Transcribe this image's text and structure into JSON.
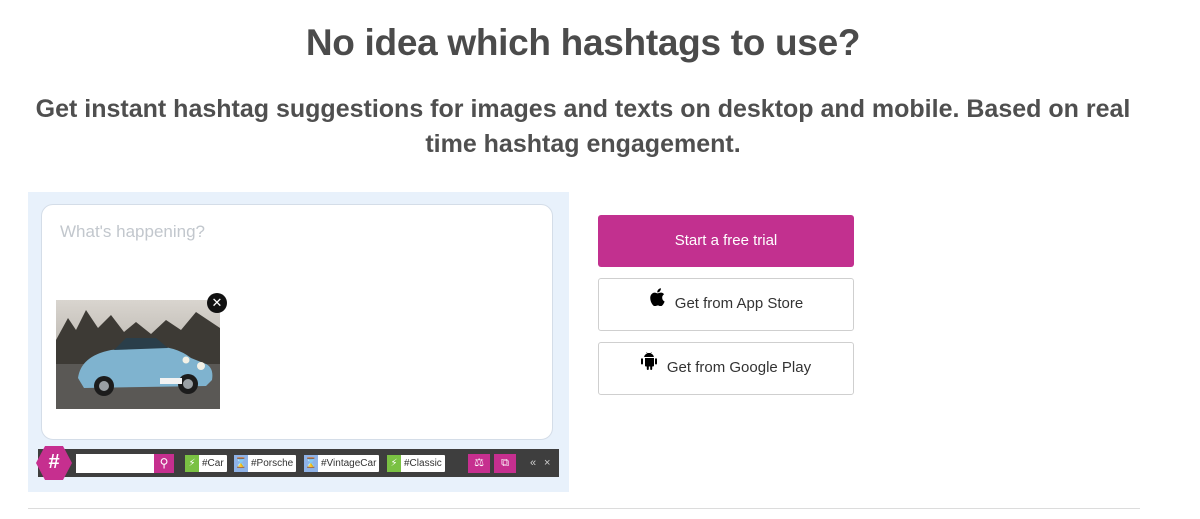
{
  "hero": {
    "title": "No idea which hashtags to use?",
    "subtitle": "Get instant hashtag suggestions for images and texts on desktop and mobile. Based on real time hashtag engagement."
  },
  "composer": {
    "placeholder": "What's happening?",
    "remove_icon": "close-icon",
    "image_subject": "light blue vintage car"
  },
  "toolbar": {
    "logo": "#",
    "search_icon": "search-icon",
    "tags": [
      {
        "label": "#Car",
        "status": "hot",
        "icon": "lightning-icon"
      },
      {
        "label": "#Porsche",
        "status": "slow",
        "icon": "hourglass-icon"
      },
      {
        "label": "#VintageCar",
        "status": "slow",
        "icon": "hourglass-icon"
      },
      {
        "label": "#Classic",
        "status": "hot",
        "icon": "lightning-icon"
      }
    ],
    "controls": {
      "collapse": "«",
      "close": "×"
    }
  },
  "cta": {
    "trial_label": "Start a free trial",
    "app_store_label": "Get from App Store",
    "google_play_label": "Get from Google Play"
  },
  "colors": {
    "brand": "#c2308f",
    "panel_bg": "#e8f1fb",
    "toolbar_bg": "#3e3e3e",
    "hot_tag": "#7ac143",
    "slow_tag": "#8fb3e8"
  }
}
